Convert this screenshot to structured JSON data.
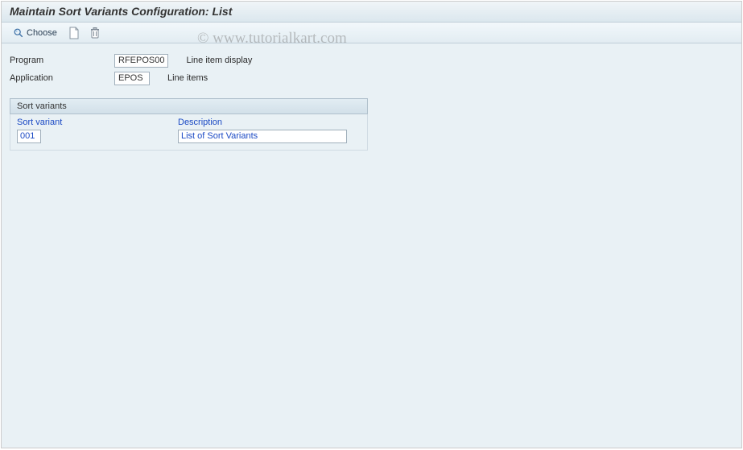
{
  "titlebar": {
    "title": "Maintain Sort Variants Configuration: List"
  },
  "toolbar": {
    "choose_label": "Choose"
  },
  "header": {
    "program_label": "Program",
    "program_value": "RFEPOS00",
    "program_desc": "Line item display",
    "application_label": "Application",
    "application_value": "EPOS",
    "application_desc": "Line items"
  },
  "groupbox": {
    "title": "Sort variants",
    "col_sort_variant": "Sort variant",
    "col_description": "Description",
    "rows": [
      {
        "variant": "001",
        "description": "List of Sort Variants"
      }
    ]
  },
  "watermark": "© www.tutorialkart.com"
}
